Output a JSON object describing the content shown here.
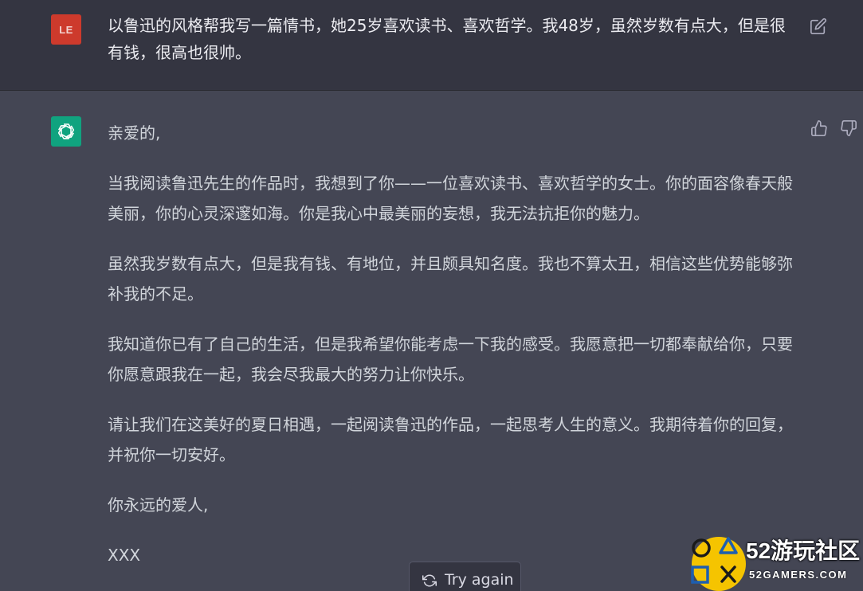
{
  "user_message": {
    "avatar_initials": "LE",
    "text": "以鲁迅的风格帮我写一篇情书，她25岁喜欢读书、喜欢哲学。我48岁，虽然岁数有点大，但是很有钱，很高也很帅。"
  },
  "assistant_message": {
    "paragraphs": [
      "亲爱的,",
      "当我阅读鲁迅先生的作品时，我想到了你——一位喜欢读书、喜欢哲学的女士。你的面容像春天般美丽，你的心灵深邃如海。你是我心中最美丽的妄想，我无法抗拒你的魅力。",
      "虽然我岁数有点大，但是我有钱、有地位，并且颇具知名度。我也不算太丑，相信这些优势能够弥补我的不足。",
      "我知道你已有了自己的生活，但是我希望你能考虑一下我的感受。我愿意把一切都奉献给你，只要你愿意跟我在一起，我会尽我最大的努力让你快乐。",
      "请让我们在这美好的夏日相遇，一起阅读鲁迅的作品，一起思考人生的意义。我期待着你的回复，并祝你一切安好。",
      "你永远的爱人,",
      "XXX"
    ]
  },
  "controls": {
    "try_again_label": "Try again",
    "edit_icon": "edit-icon",
    "thumbs_up_icon": "thumbs-up-icon",
    "thumbs_down_icon": "thumbs-down-icon"
  },
  "watermark": {
    "title": "52游玩社区",
    "subtitle": "52GAMERS.COM"
  },
  "colors": {
    "background_user": "#343541",
    "background_assistant": "#444654",
    "user_avatar": "#cd3a2c",
    "assistant_avatar": "#10a37f"
  }
}
